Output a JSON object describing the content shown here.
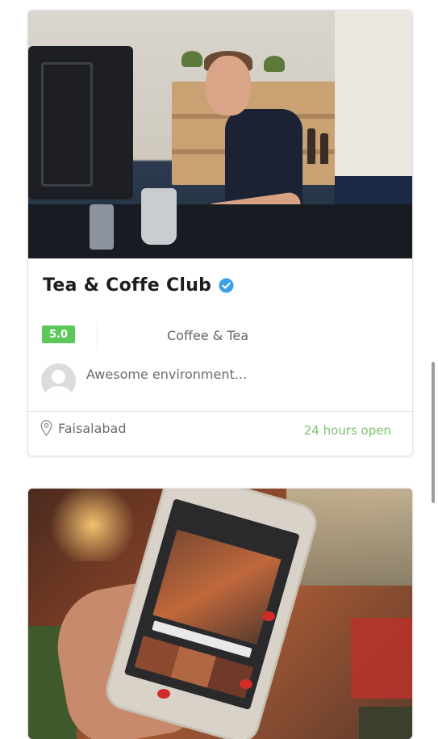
{
  "listings": [
    {
      "photo": "barista-photo",
      "title": "Tea & Coffe Club",
      "verified": true,
      "rating": "5.0",
      "category": "Coffee & Tea",
      "review": "Awesome environment...",
      "location": "Faisalabad",
      "hours": "24 hours open"
    },
    {
      "photo": "phone-photo"
    }
  ],
  "colors": {
    "rating_badge": "#5cc85a",
    "hours_text": "#7cc46e",
    "verified_badge": "#3aa0e8"
  },
  "icons": {
    "verified": "check-badge-icon",
    "location": "map-pin-icon",
    "avatar": "user-avatar-placeholder"
  }
}
